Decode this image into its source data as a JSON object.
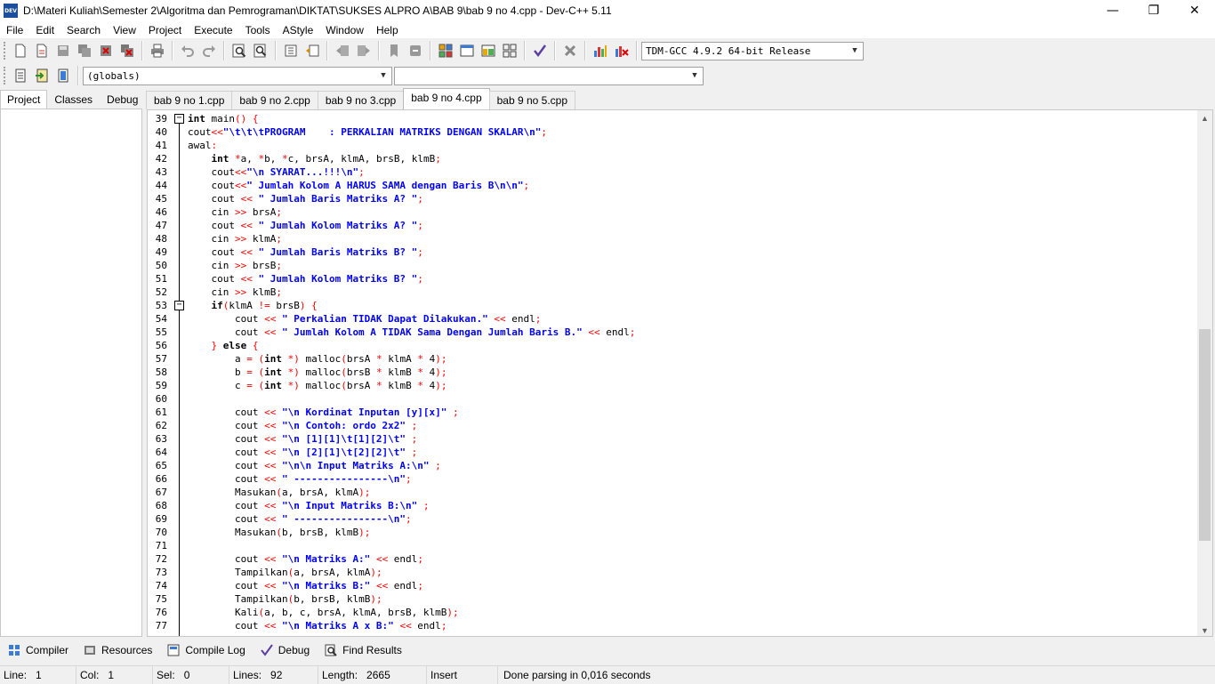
{
  "window": {
    "title": "D:\\Materi Kuliah\\Semester 2\\Algoritma dan Pemrograman\\DIKTAT\\SUKSES ALPRO A\\BAB 9\\bab 9 no 4.cpp - Dev-C++ 5.11",
    "icon_text": "DEV",
    "minimize": "—",
    "maximize": "❐",
    "close": "✕"
  },
  "menu": [
    "File",
    "Edit",
    "Search",
    "View",
    "Project",
    "Execute",
    "Tools",
    "AStyle",
    "Window",
    "Help"
  ],
  "toolbar": {
    "compiler_select": "TDM-GCC 4.9.2 64-bit Release",
    "scope_select": "(globals)",
    "member_select": ""
  },
  "left_tabs": [
    "Project",
    "Classes",
    "Debug"
  ],
  "editor_tabs": [
    "bab 9 no 1.cpp",
    "bab 9 no 2.cpp",
    "bab 9 no 3.cpp",
    "bab 9 no 4.cpp",
    "bab 9 no 5.cpp"
  ],
  "active_editor_tab": "bab 9 no 4.cpp",
  "code": {
    "line_numbers": [
      "39",
      "40",
      "41",
      "42",
      "43",
      "44",
      "45",
      "46",
      "47",
      "48",
      "49",
      "50",
      "51",
      "52",
      "53",
      "54",
      "55",
      "56",
      "57",
      "58",
      "59",
      "60",
      "61",
      "62",
      "63",
      "64",
      "65",
      "66",
      "67",
      "68",
      "69",
      "70",
      "71",
      "72",
      "73",
      "74",
      "75",
      "76",
      "77"
    ],
    "lines": [
      "int main() {",
      "cout<<\"\\t\\t\\tPROGRAM    : PERKALIAN MATRIKS DENGAN SKALAR\\n\";",
      "awal:",
      "    int *a, *b, *c, brsA, klmA, brsB, klmB;",
      "    cout<<\"\\n SYARAT...!!!\\n\";",
      "    cout<<\" Jumlah Kolom A HARUS SAMA dengan Baris B\\n\\n\";",
      "    cout << \" Jumlah Baris Matriks A? \";",
      "    cin >> brsA;",
      "    cout << \" Jumlah Kolom Matriks A? \";",
      "    cin >> klmA;",
      "    cout << \" Jumlah Baris Matriks B? \";",
      "    cin >> brsB;",
      "    cout << \" Jumlah Kolom Matriks B? \";",
      "    cin >> klmB;",
      "    if(klmA != brsB) {",
      "        cout << \" Perkalian TIDAK Dapat Dilakukan.\" << endl;",
      "        cout << \" Jumlah Kolom A TIDAK Sama Dengan Jumlah Baris B.\" << endl;",
      "    } else {",
      "        a = (int *) malloc(brsA * klmA * 4);",
      "        b = (int *) malloc(brsB * klmB * 4);",
      "        c = (int *) malloc(brsA * klmB * 4);",
      "",
      "        cout << \"\\n Kordinat Inputan [y][x]\" ;",
      "        cout << \"\\n Contoh: ordo 2x2\" ;",
      "        cout << \"\\n [1][1]\\t[1][2]\\t\" ;",
      "        cout << \"\\n [2][1]\\t[2][2]\\t\" ;",
      "        cout << \"\\n\\n Input Matriks A:\\n\" ;",
      "        cout << \" ----------------\\n\";",
      "        Masukan(a, brsA, klmA);",
      "        cout << \"\\n Input Matriks B:\\n\" ;",
      "        cout << \" ----------------\\n\";",
      "        Masukan(b, brsB, klmB);",
      "",
      "        cout << \"\\n Matriks A:\" << endl;",
      "        Tampilkan(a, brsA, klmA);",
      "        cout << \"\\n Matriks B:\" << endl;",
      "        Tampilkan(b, brsB, klmB);",
      "        Kali(a, b, c, brsA, klmA, brsB, klmB);",
      "        cout << \"\\n Matriks A x B:\" << endl;"
    ]
  },
  "bottom_tabs": [
    "Compiler",
    "Resources",
    "Compile Log",
    "Debug",
    "Find Results"
  ],
  "status": {
    "line_label": "Line:",
    "line_value": "1",
    "col_label": "Col:",
    "col_value": "1",
    "sel_label": "Sel:",
    "sel_value": "0",
    "lines_label": "Lines:",
    "lines_value": "92",
    "length_label": "Length:",
    "length_value": "2665",
    "mode": "Insert",
    "message": "Done parsing in 0,016 seconds"
  }
}
